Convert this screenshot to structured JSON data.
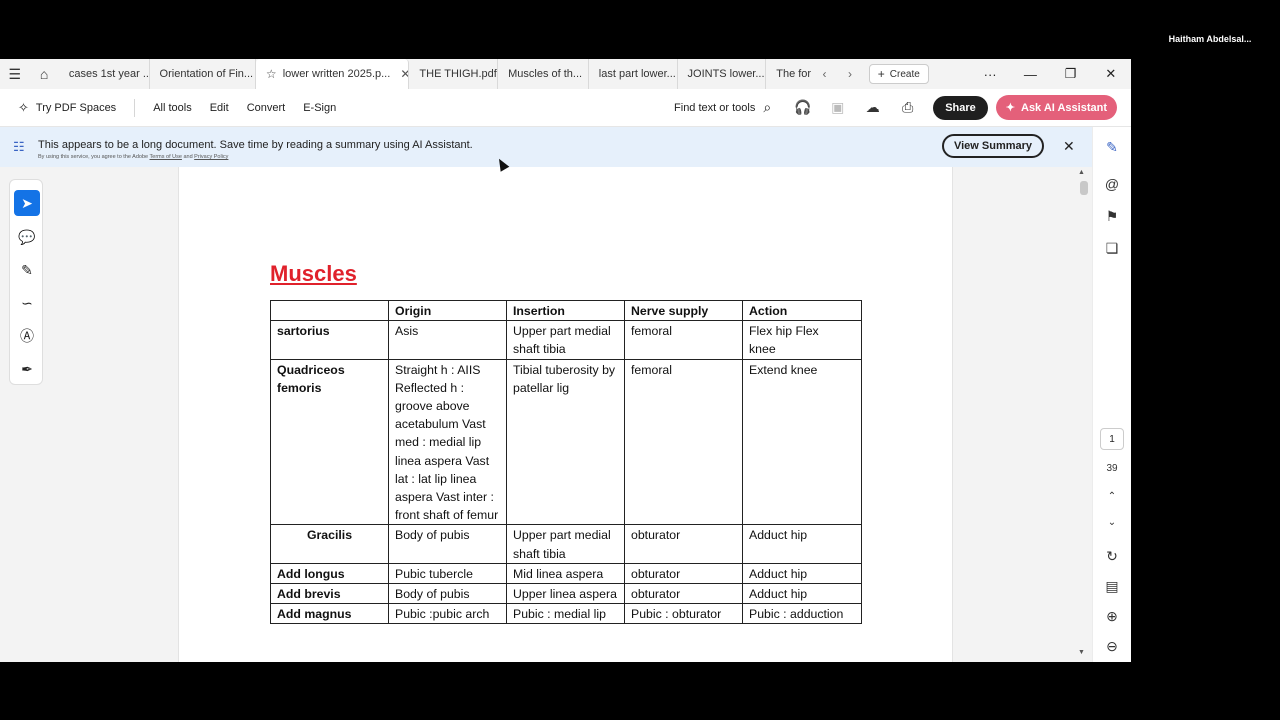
{
  "meeting": {
    "participant_name": "Haitham  Abdelsal..."
  },
  "tabs": [
    {
      "label": "cases 1st year ..."
    },
    {
      "label": "Orientation of Fin..."
    },
    {
      "label": "lower written 2025.p..."
    },
    {
      "label": "THE THIGH.pdf"
    },
    {
      "label": "Muscles of th..."
    },
    {
      "label": "last part lower..."
    },
    {
      "label": "JOINTS lower..."
    },
    {
      "label": "The for"
    }
  ],
  "tabbar": {
    "create_label": "Create"
  },
  "toolbar": {
    "spaces_label": "Try PDF Spaces",
    "all_tools": "All tools",
    "edit": "Edit",
    "convert": "Convert",
    "esign": "E-Sign",
    "find_label": "Find text or tools",
    "share_label": "Share",
    "ai_label": "Ask AI Assistant"
  },
  "banner": {
    "message": "This appears to be a long document. Save time by reading a summary using AI Assistant.",
    "legal_prefix": "By using this service, you agree to the Adobe",
    "terms": "Terms of Use",
    "and": "and",
    "privacy": "Privacy Policy",
    "view_summary": "View Summary"
  },
  "pager": {
    "current": "1",
    "total": "39"
  },
  "document": {
    "heading": "Muscles",
    "columns": [
      "",
      "Origin",
      "Insertion",
      "Nerve supply",
      "Action"
    ],
    "rows": [
      {
        "name": "sartorius",
        "origin": "Asis",
        "insertion": "Upper part medial shaft tibia",
        "nerve": "femoral",
        "action": "Flex hip Flex knee"
      },
      {
        "name": "Quadriceos femoris",
        "origin": "Straight h : AIIS Reflected h : groove above acetabulum Vast med : medial lip linea aspera Vast lat : lat lip linea aspera Vast inter : front shaft of femur",
        "insertion": "Tibial tuberosity by patellar lig",
        "nerve": "femoral",
        "action": "Extend knee"
      },
      {
        "name": "Gracilis",
        "origin": "Body of pubis",
        "insertion": "Upper part medial shaft tibia",
        "nerve": "obturator",
        "action": "Adduct hip"
      },
      {
        "name": "Add longus",
        "origin": "Pubic tubercle",
        "insertion": "Mid linea aspera",
        "nerve": "obturator",
        "action": "Adduct hip"
      },
      {
        "name": "Add brevis",
        "origin": "Body of pubis",
        "insertion": "Upper linea aspera",
        "nerve": "obturator",
        "action": "Adduct hip"
      },
      {
        "name": "Add magnus",
        "origin": "Pubic :pubic arch",
        "insertion": "Pubic : medial lip",
        "nerve": "Pubic : obturator",
        "action": "Pubic : adduction"
      }
    ]
  }
}
